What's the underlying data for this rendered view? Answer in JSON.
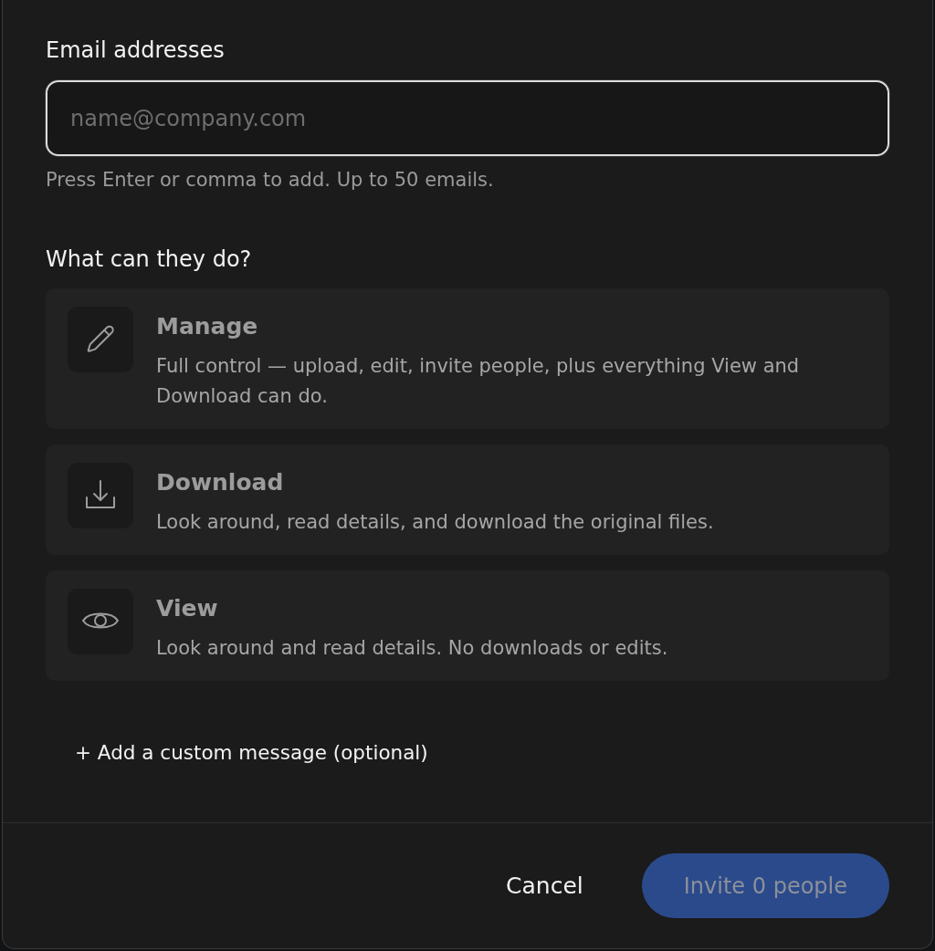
{
  "email_field": {
    "label": "Email addresses",
    "placeholder": "name@company.com",
    "focused": true,
    "hint": "Press Enter or comma to add. Up to 50 emails."
  },
  "permissions": {
    "heading": "What can they do?",
    "options": [
      {
        "kind": "manage",
        "title": "Manage",
        "description": "Full control — upload, edit, invite people, plus everything View and Download can do.",
        "selected": false
      },
      {
        "kind": "download",
        "title": "Download",
        "description": "Look around, read details, and download the original files.",
        "selected": false
      },
      {
        "kind": "view",
        "title": "View",
        "description": "Look around and read details. No downloads or edits.",
        "selected": false
      }
    ]
  },
  "custom_message_link": "+ Add a custom message (optional)",
  "footer": {
    "cancel": "Cancel",
    "submit": {
      "label": "Invite 0 people",
      "disabled": true
    }
  }
}
